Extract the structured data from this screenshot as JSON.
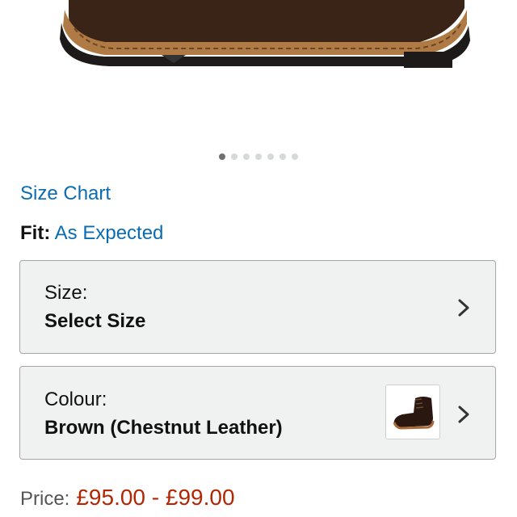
{
  "product": {
    "image_alt": "shoe-photo",
    "carousel": {
      "count": 7,
      "active_index": 0
    }
  },
  "links": {
    "size_chart": "Size Chart"
  },
  "fit": {
    "label": "Fit:",
    "value": "As Expected"
  },
  "size_selector": {
    "label": "Size:",
    "value": "Select Size"
  },
  "colour_selector": {
    "label": "Colour:",
    "value": "Brown (Chestnut Leather)"
  },
  "price": {
    "label": "Price:",
    "value": "£95.00 - £99.00"
  },
  "colors": {
    "link": "#0a6cb3",
    "price": "#b12704",
    "selector_bg": "#f0f2f2"
  }
}
